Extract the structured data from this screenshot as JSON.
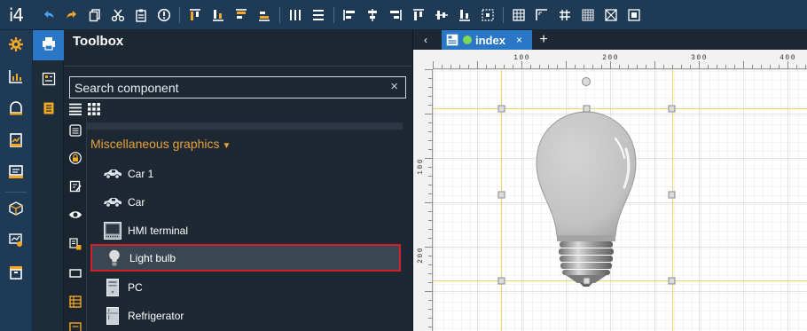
{
  "app": {
    "logo": "i4"
  },
  "toolbar": {
    "icons": [
      "undo-icon",
      "redo-icon",
      "copy-icon",
      "cut-icon",
      "paste-icon",
      "info-icon",
      "align-top-icon",
      "align-bottom-icon",
      "align-top-alt-icon",
      "align-bottom-alt-icon",
      "distribute-horizontal-icon",
      "distribute-vertical-icon",
      "align-left-icon",
      "align-center-icon",
      "align-right-icon",
      "align-top-edge-icon",
      "align-middle-icon",
      "align-bottom-edge-icon",
      "fit-icon",
      "grid-icon",
      "snap-icon",
      "grid-size-icon",
      "grid-size-alt-icon",
      "grid-toggle-icon",
      "grid-settings-icon"
    ]
  },
  "toolbox": {
    "title": "Toolbox",
    "search_placeholder": "Search component",
    "clear": "×",
    "category": "Miscellaneous graphics",
    "items": [
      {
        "label": "Car 1",
        "icon": "car-icon"
      },
      {
        "label": "Car",
        "icon": "car-icon"
      },
      {
        "label": "HMI terminal",
        "icon": "hmi-terminal-icon"
      },
      {
        "label": "Light bulb",
        "icon": "light-bulb-icon",
        "selected": true
      },
      {
        "label": "PC",
        "icon": "pc-icon"
      },
      {
        "label": "Refrigerator",
        "icon": "refrigerator-icon"
      }
    ]
  },
  "tabs": {
    "back": "‹",
    "active": {
      "label": "index",
      "close": "×"
    },
    "add": "+"
  },
  "ruler": {
    "h_labels": [
      "100",
      "200",
      "300",
      "400"
    ],
    "v_labels": [
      "100",
      "200"
    ]
  },
  "colors": {
    "accent": "#2a77c5",
    "toolbar_icon_blue": "#4aa3ff",
    "toolbar_icon_orange": "#f5a623",
    "category_orange": "#e8a23a",
    "selection_red": "#d0212a",
    "status_green": "#7ed957"
  }
}
